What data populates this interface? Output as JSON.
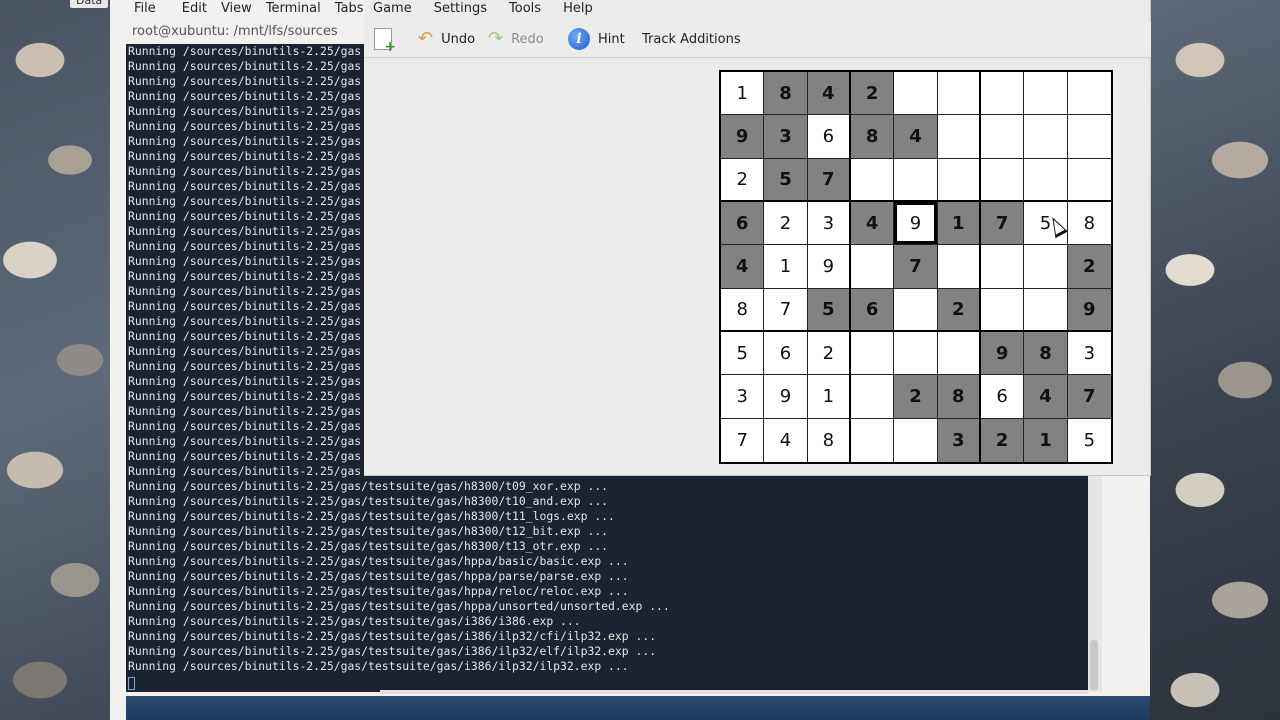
{
  "desktop": {
    "label": "Data"
  },
  "terminal": {
    "menu": [
      "File",
      "Edit",
      "View",
      "Terminal",
      "Tabs"
    ],
    "title": "root@xubuntu: /mnt/lfs/sources",
    "lines": [
      "Running /sources/binutils-2.25/gas",
      "Running /sources/binutils-2.25/gas",
      "Running /sources/binutils-2.25/gas",
      "Running /sources/binutils-2.25/gas",
      "Running /sources/binutils-2.25/gas",
      "Running /sources/binutils-2.25/gas",
      "Running /sources/binutils-2.25/gas",
      "Running /sources/binutils-2.25/gas",
      "Running /sources/binutils-2.25/gas",
      "Running /sources/binutils-2.25/gas",
      "Running /sources/binutils-2.25/gas",
      "Running /sources/binutils-2.25/gas",
      "Running /sources/binutils-2.25/gas",
      "Running /sources/binutils-2.25/gas",
      "Running /sources/binutils-2.25/gas",
      "Running /sources/binutils-2.25/gas",
      "Running /sources/binutils-2.25/gas",
      "Running /sources/binutils-2.25/gas",
      "Running /sources/binutils-2.25/gas",
      "Running /sources/binutils-2.25/gas",
      "Running /sources/binutils-2.25/gas",
      "Running /sources/binutils-2.25/gas",
      "Running /sources/binutils-2.25/gas",
      "Running /sources/binutils-2.25/gas",
      "Running /sources/binutils-2.25/gas",
      "Running /sources/binutils-2.25/gas",
      "Running /sources/binutils-2.25/gas",
      "Running /sources/binutils-2.25/gas",
      "Running /sources/binutils-2.25/gas",
      "Running /sources/binutils-2.25/gas/testsuite/gas/h8300/t09_xor.exp ...",
      "Running /sources/binutils-2.25/gas/testsuite/gas/h8300/t10_and.exp ...",
      "Running /sources/binutils-2.25/gas/testsuite/gas/h8300/t11_logs.exp ...",
      "Running /sources/binutils-2.25/gas/testsuite/gas/h8300/t12_bit.exp ...",
      "Running /sources/binutils-2.25/gas/testsuite/gas/h8300/t13_otr.exp ...",
      "Running /sources/binutils-2.25/gas/testsuite/gas/hppa/basic/basic.exp ...",
      "Running /sources/binutils-2.25/gas/testsuite/gas/hppa/parse/parse.exp ...",
      "Running /sources/binutils-2.25/gas/testsuite/gas/hppa/reloc/reloc.exp ...",
      "Running /sources/binutils-2.25/gas/testsuite/gas/hppa/unsorted/unsorted.exp ...",
      "Running /sources/binutils-2.25/gas/testsuite/gas/i386/i386.exp ...",
      "Running /sources/binutils-2.25/gas/testsuite/gas/i386/ilp32/cfi/ilp32.exp ...",
      "Running /sources/binutils-2.25/gas/testsuite/gas/i386/ilp32/elf/ilp32.exp ...",
      "Running /sources/binutils-2.25/gas/testsuite/gas/i386/ilp32/ilp32.exp ..."
    ]
  },
  "sudoku": {
    "menu": [
      "Game",
      "Settings",
      "Tools",
      "Help"
    ],
    "toolbar": {
      "undo": "Undo",
      "redo": "Redo",
      "hint": "Hint",
      "track": "Track Additions"
    },
    "grid": [
      [
        [
          "1",
          0
        ],
        [
          "8",
          1
        ],
        [
          "4",
          1
        ],
        [
          "2",
          1
        ],
        [
          "",
          0
        ],
        [
          "",
          0
        ],
        [
          "",
          0
        ],
        [
          "",
          0
        ],
        [
          "",
          0
        ]
      ],
      [
        [
          "9",
          1
        ],
        [
          "3",
          1
        ],
        [
          "6",
          0
        ],
        [
          "8",
          1
        ],
        [
          "4",
          1
        ],
        [
          "",
          0
        ],
        [
          "",
          0
        ],
        [
          "",
          0
        ],
        [
          "",
          0
        ]
      ],
      [
        [
          "2",
          0
        ],
        [
          "5",
          1
        ],
        [
          "7",
          1
        ],
        [
          "",
          0
        ],
        [
          "",
          0
        ],
        [
          "",
          0
        ],
        [
          "",
          0
        ],
        [
          "",
          0
        ],
        [
          "",
          0
        ]
      ],
      [
        [
          "6",
          1
        ],
        [
          "2",
          0
        ],
        [
          "3",
          0
        ],
        [
          "4",
          1
        ],
        [
          "9",
          0
        ],
        [
          "1",
          1
        ],
        [
          "7",
          1
        ],
        [
          "5",
          0
        ],
        [
          "8",
          0
        ]
      ],
      [
        [
          "4",
          1
        ],
        [
          "1",
          0
        ],
        [
          "9",
          0
        ],
        [
          "",
          0
        ],
        [
          "7",
          1
        ],
        [
          "",
          0
        ],
        [
          "",
          0
        ],
        [
          "",
          0
        ],
        [
          "2",
          1
        ]
      ],
      [
        [
          "8",
          0
        ],
        [
          "7",
          0
        ],
        [
          "5",
          1
        ],
        [
          "6",
          1
        ],
        [
          "",
          0
        ],
        [
          "2",
          1
        ],
        [
          "",
          0
        ],
        [
          "",
          0
        ],
        [
          "9",
          1
        ]
      ],
      [
        [
          "5",
          0
        ],
        [
          "6",
          0
        ],
        [
          "2",
          0
        ],
        [
          "",
          0
        ],
        [
          "",
          0
        ],
        [
          "",
          0
        ],
        [
          "9",
          1
        ],
        [
          "8",
          1
        ],
        [
          "3",
          0
        ]
      ],
      [
        [
          "3",
          0
        ],
        [
          "9",
          0
        ],
        [
          "1",
          0
        ],
        [
          "",
          0
        ],
        [
          "2",
          1
        ],
        [
          "8",
          1
        ],
        [
          "6",
          0
        ],
        [
          "4",
          1
        ],
        [
          "7",
          1
        ]
      ],
      [
        [
          "7",
          0
        ],
        [
          "4",
          0
        ],
        [
          "8",
          0
        ],
        [
          "",
          0
        ],
        [
          "",
          0
        ],
        [
          "3",
          1
        ],
        [
          "2",
          1
        ],
        [
          "1",
          1
        ],
        [
          "5",
          0
        ]
      ]
    ],
    "selected_cell": [
      3,
      4
    ],
    "colors": {
      "given_cell": "#828282",
      "empty_cell": "#ffffff",
      "grid_line": "#000000"
    }
  }
}
